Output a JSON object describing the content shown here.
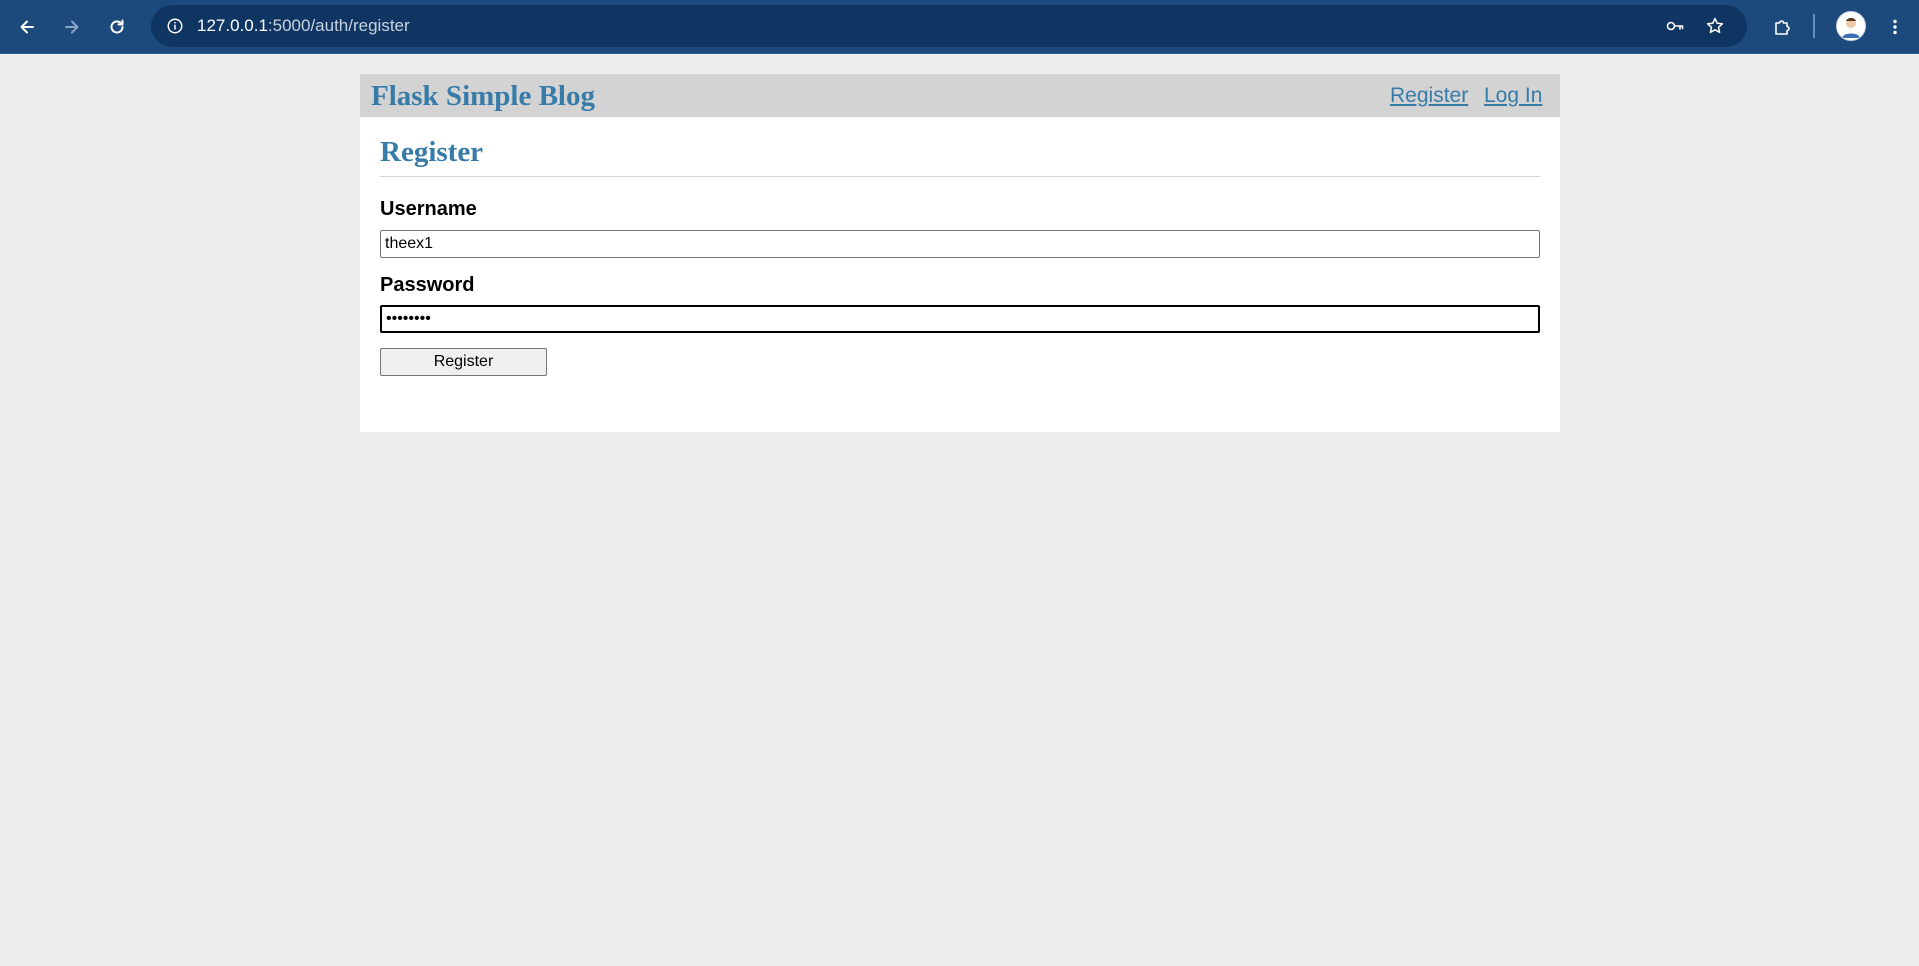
{
  "browser": {
    "url_host": "127.0.0.1",
    "url_rest": ":5000/auth/register"
  },
  "site": {
    "title": "Flask Simple Blog",
    "nav": {
      "register": "Register",
      "login": "Log In"
    }
  },
  "form": {
    "heading": "Register",
    "username_label": "Username",
    "username_value": "theex1",
    "password_label": "Password",
    "password_value": "••••••••",
    "submit_label": "Register"
  },
  "colors": {
    "link": "#377ba8",
    "nav_bg": "#d3d3d3",
    "page_bg": "#ededed",
    "toolbar": "#1c4a7c"
  }
}
